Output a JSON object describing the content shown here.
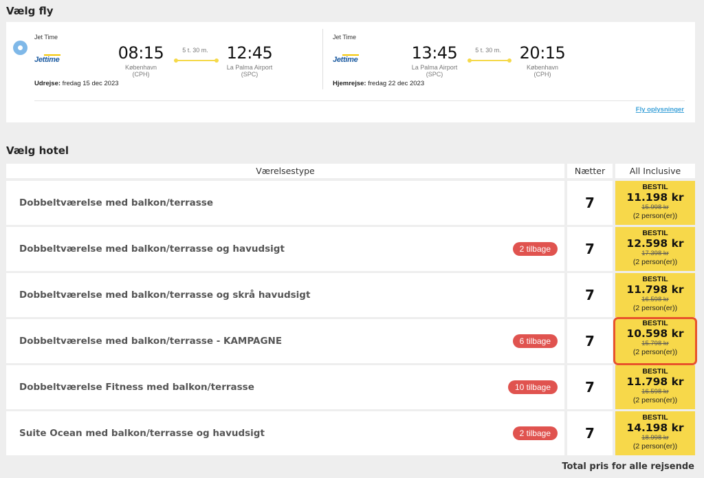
{
  "flight_section": {
    "title": "Vælg fly",
    "outbound": {
      "airline": "Jet Time",
      "logo_text": "Jettime",
      "dep_time": "08:15",
      "dep_city": "København",
      "dep_code": "(CPH)",
      "duration": "5 t. 30 m.",
      "arr_time": "12:45",
      "arr_city": "La Palma Airport",
      "arr_code": "(SPC)",
      "date_label": "Udrejse:",
      "date": "fredag 15 dec 2023"
    },
    "return": {
      "airline": "Jet Time",
      "logo_text": "Jettime",
      "dep_time": "13:45",
      "dep_city": "La Palma Airport",
      "dep_code": "(SPC)",
      "duration": "5 t. 30 m.",
      "arr_time": "20:15",
      "arr_city": "København",
      "arr_code": "(CPH)",
      "date_label": "Hjemrejse:",
      "date": "fredag 22 dec 2023"
    },
    "info_link": "Fly oplysninger"
  },
  "hotel_section": {
    "title": "Vælg hotel",
    "headers": {
      "room_type": "Værelsestype",
      "nights": "Nætter",
      "board": "All Inclusive"
    },
    "rooms": [
      {
        "name": "Dobbeltværelse med balkon/terrasse",
        "badge": "",
        "nights": "7",
        "cta": "BESTIL",
        "price": "11.198 kr",
        "old_price": "15.998 kr",
        "persons": "(2 person(er))"
      },
      {
        "name": "Dobbeltværelse med balkon/terrasse og havudsigt",
        "badge": "2 tilbage",
        "nights": "7",
        "cta": "BESTIL",
        "price": "12.598 kr",
        "old_price": "17.398 kr",
        "persons": "(2 person(er))"
      },
      {
        "name": "Dobbeltværelse med balkon/terrasse og skrå havudsigt",
        "badge": "",
        "nights": "7",
        "cta": "BESTIL",
        "price": "11.798 kr",
        "old_price": "16.598 kr",
        "persons": "(2 person(er))"
      },
      {
        "name": "Dobbeltværelse med balkon/terrasse - KAMPAGNE",
        "badge": "6 tilbage",
        "nights": "7",
        "cta": "BESTIL",
        "price": "10.598 kr",
        "old_price": "15.798 kr",
        "persons": "(2 person(er))"
      },
      {
        "name": "Dobbeltværelse Fitness med balkon/terrasse",
        "badge": "10 tilbage",
        "nights": "7",
        "cta": "BESTIL",
        "price": "11.798 kr",
        "old_price": "16.598 kr",
        "persons": "(2 person(er))"
      },
      {
        "name": "Suite Ocean med balkon/terrasse og havudsigt",
        "badge": "2 tilbage",
        "nights": "7",
        "cta": "BESTIL",
        "price": "14.198 kr",
        "old_price": "18.998 kr",
        "persons": "(2 person(er))"
      }
    ],
    "selected_room_index": 3,
    "total_label": "Total pris for alle rejsende"
  },
  "colors": {
    "price_bg": "#f7d84a",
    "badge_bg": "#e0534f",
    "selected_border": "#e8532b",
    "link": "#3aa0d8",
    "radio": "#7fb8e8"
  }
}
